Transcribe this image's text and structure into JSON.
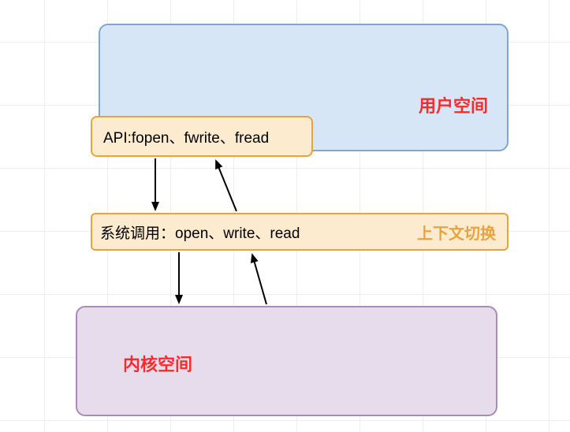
{
  "diagram": {
    "user_space_label": "用户空间",
    "api_box_text": "API:fopen、fwrite、fread",
    "syscall_text": "系统调用：open、write、read",
    "context_switch_label": "上下文切换",
    "kernel_space_label": "内核空间"
  }
}
